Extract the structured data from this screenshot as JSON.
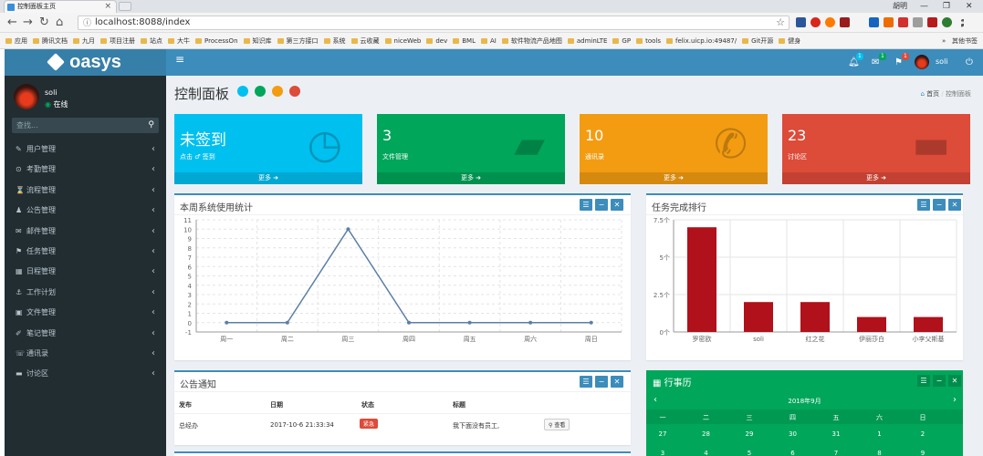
{
  "browser": {
    "tab_title": "控制面板主页",
    "url": "localhost:8088/index",
    "bookmarks": [
      "应用",
      "腾讯文档",
      "九月",
      "项目注册",
      "站点",
      "大牛",
      "ProcessOn",
      "知识库",
      "第三方接口",
      "系统",
      "云收藏",
      "niceWeb",
      "dev",
      "BML",
      "AI",
      "软件物流产品地图",
      "adminLTE",
      "GP",
      "tools",
      "felix.uicp.io:49487/",
      "Git开源",
      "健身"
    ],
    "bookmarks_more": "»",
    "other_bookmarks": "其他书签",
    "window_controls": {
      "user": "胡明"
    }
  },
  "sidebar": {
    "logo": "oasys",
    "user_name": "soli",
    "user_status": "在线",
    "search_placeholder": "查找...",
    "items": [
      {
        "label": "用户管理",
        "icon": "✎"
      },
      {
        "label": "考勤管理",
        "icon": "⊙"
      },
      {
        "label": "流程管理",
        "icon": "⌛"
      },
      {
        "label": "公告管理",
        "icon": "♟"
      },
      {
        "label": "邮件管理",
        "icon": "✉"
      },
      {
        "label": "任务管理",
        "icon": "⚑"
      },
      {
        "label": "日程管理",
        "icon": "▦"
      },
      {
        "label": "工作计划",
        "icon": "⚓"
      },
      {
        "label": "文件管理",
        "icon": "▣"
      },
      {
        "label": "笔记管理",
        "icon": "✐"
      },
      {
        "label": "通讯录",
        "icon": "☏"
      },
      {
        "label": "讨论区",
        "icon": "▬"
      }
    ]
  },
  "header": {
    "badges": [
      "1",
      "1",
      "1"
    ],
    "user_name": "soli"
  },
  "page": {
    "title": "控制面板",
    "dot_colors": [
      "#00c0ef",
      "#00a65a",
      "#f39c12",
      "#dd4b39"
    ],
    "breadcrumb": {
      "home": "首页",
      "current": "控制面板"
    }
  },
  "stat_boxes": [
    {
      "number": "未签到",
      "label": "点击 ♂ 签到",
      "footer": "更多 ➜",
      "color": "#00c0ef",
      "icon": "clock-icon"
    },
    {
      "number": "3",
      "label": "文件管理",
      "footer": "更多 ➜",
      "color": "#00a65a",
      "icon": "folder-icon"
    },
    {
      "number": "10",
      "label": "通讯录",
      "footer": "更多 ➜",
      "color": "#f39c12",
      "icon": "phone-icon"
    },
    {
      "number": "23",
      "label": "讨论区",
      "footer": "更多 ➜",
      "color": "#dd4b39",
      "icon": "comment-icon"
    }
  ],
  "panels": {
    "usage_title": "本周系统使用统计",
    "rank_title": "任务完成排行",
    "notice_title": "公告通知",
    "calendar_title": "行事历"
  },
  "chart_data": [
    {
      "type": "line",
      "title": "本周系统使用统计",
      "categories": [
        "周一",
        "周二",
        "周三",
        "周四",
        "周五",
        "周六",
        "周日"
      ],
      "values": [
        0,
        0,
        10,
        0,
        0,
        0,
        0
      ],
      "ylim": [
        -1,
        11
      ],
      "yticks": [
        -1,
        0,
        1,
        2,
        3,
        4,
        5,
        6,
        7,
        8,
        9,
        10,
        11
      ],
      "grid": true,
      "color": "#5b7fa6"
    },
    {
      "type": "bar",
      "title": "任务完成排行",
      "categories": [
        "罗密欧",
        "soli",
        "红之花",
        "伊丽莎白",
        "小李父斯基"
      ],
      "values": [
        7,
        2,
        2,
        1,
        1
      ],
      "ylim": [
        0,
        7.5
      ],
      "yticks": [
        "0个",
        "2.5个",
        "5个",
        "7.5个"
      ],
      "grid": true,
      "color": "#b0111b"
    }
  ],
  "notice_table": {
    "headers": [
      "发布",
      "日期",
      "状态",
      "标题"
    ],
    "rows": [
      {
        "author": "总经办",
        "date": "2017-10-6 21:33:34",
        "status": "紧急",
        "title": "我下面没有员工,",
        "action": "查看"
      }
    ]
  },
  "calendar": {
    "month": "2018年9月",
    "weekdays": [
      "一",
      "二",
      "三",
      "四",
      "五",
      "六",
      "日"
    ],
    "weeks": [
      [
        "27",
        "28",
        "29",
        "30",
        "31",
        "1",
        "2"
      ],
      [
        "3",
        "4",
        "5",
        "6",
        "7",
        "8",
        "9"
      ]
    ]
  }
}
